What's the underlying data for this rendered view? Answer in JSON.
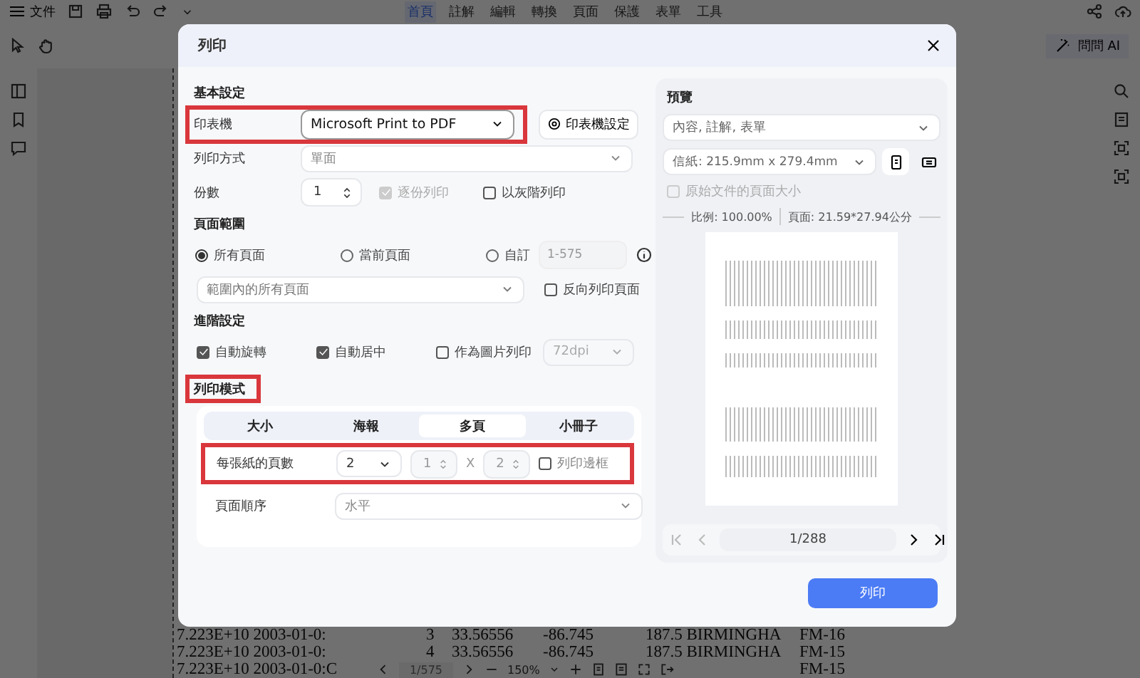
{
  "app": {
    "menu_label": "文件",
    "menu_tabs": [
      {
        "label": "首頁",
        "selected": true
      },
      {
        "label": "註解",
        "selected": false
      },
      {
        "label": "編輯",
        "selected": false
      },
      {
        "label": "轉換",
        "selected": false
      },
      {
        "label": "頁面",
        "selected": false
      },
      {
        "label": "保護",
        "selected": false
      },
      {
        "label": "表單",
        "selected": false
      },
      {
        "label": "工具",
        "selected": false
      }
    ],
    "ask_ai": "問問 AI"
  },
  "document": {
    "rows": [
      {
        "column_1": "7.223E+10 2003-01-0:",
        "column_2": "3",
        "column_3": "33.56556",
        "column_4": "-86.745",
        "column_5": "187.5 BIRMINGHA",
        "column_6": "FM-16"
      },
      {
        "column_1": "7.223E+10 2003-01-0:",
        "column_2": "4",
        "column_3": "33.56556",
        "column_4": "-86.745",
        "column_5": "187.5 BIRMINGHA",
        "column_6": "FM-15"
      },
      {
        "column_1": "7.223E+10 2003-01-0:C",
        "column_6": "FM-15"
      }
    ]
  },
  "zoom_bar": {
    "page": "1/575",
    "zoom": "150%"
  },
  "dialog": {
    "title": "列印",
    "basic": {
      "heading": "基本設定",
      "printer_label": "印表機",
      "printer": "Microsoft Print to PDF",
      "printer_settings": "印表機設定",
      "method_label": "列印方式",
      "method": "單面",
      "copies_label": "份數",
      "copies": "1",
      "options": [
        {
          "label": "逐份列印",
          "checked": true,
          "disabled": true
        },
        {
          "label": "以灰階列印",
          "checked": false,
          "disabled": false
        }
      ]
    },
    "range": {
      "heading": "頁面範圍",
      "radios": [
        {
          "label": "所有頁面",
          "selected": true
        },
        {
          "label": "當前頁面",
          "selected": false
        },
        {
          "label": "自訂",
          "selected": false
        }
      ],
      "custom_placeholder": "1-575",
      "subset": "範圍內的所有頁面",
      "reverse": {
        "label": "反向列印頁面",
        "checked": false
      }
    },
    "advanced": {
      "heading": "進階設定",
      "options": [
        {
          "label": "自動旋轉",
          "checked": true
        },
        {
          "label": "自動居中",
          "checked": true
        },
        {
          "label": "作為圖片列印",
          "checked": false
        }
      ],
      "dpi": {
        "value": "72dpi",
        "disabled": true
      }
    },
    "mode": {
      "heading": "列印模式",
      "tabs": [
        {
          "label": "大小",
          "selected": false
        },
        {
          "label": "海報",
          "selected": false
        },
        {
          "label": "多頁",
          "selected": true
        },
        {
          "label": "小冊子",
          "selected": false
        }
      ],
      "pages_per_sheet_label": "每張紙的頁數",
      "pages_per_sheet": "2",
      "columns": {
        "value": "1",
        "disabled": true
      },
      "times": "X",
      "rows": {
        "value": "2",
        "disabled": true
      },
      "border": {
        "label": "列印邊框",
        "checked": false
      },
      "order_label": "頁面順序",
      "order": "水平"
    },
    "preview": {
      "heading": "預覽",
      "content": "內容, 註解, 表單",
      "paper": "信紙: 215.9mm x 279.4mm",
      "orientations": [
        {
          "kind": "portrait",
          "selected": true
        },
        {
          "kind": "landscape",
          "selected": false
        }
      ],
      "original_size": {
        "label": "原始文件的頁面大小",
        "checked": false,
        "disabled": true
      },
      "scale": "比例: 100.00%",
      "page_size": "頁面: 21.59*27.94公分",
      "page": "1/288"
    },
    "print_button": "列印"
  }
}
